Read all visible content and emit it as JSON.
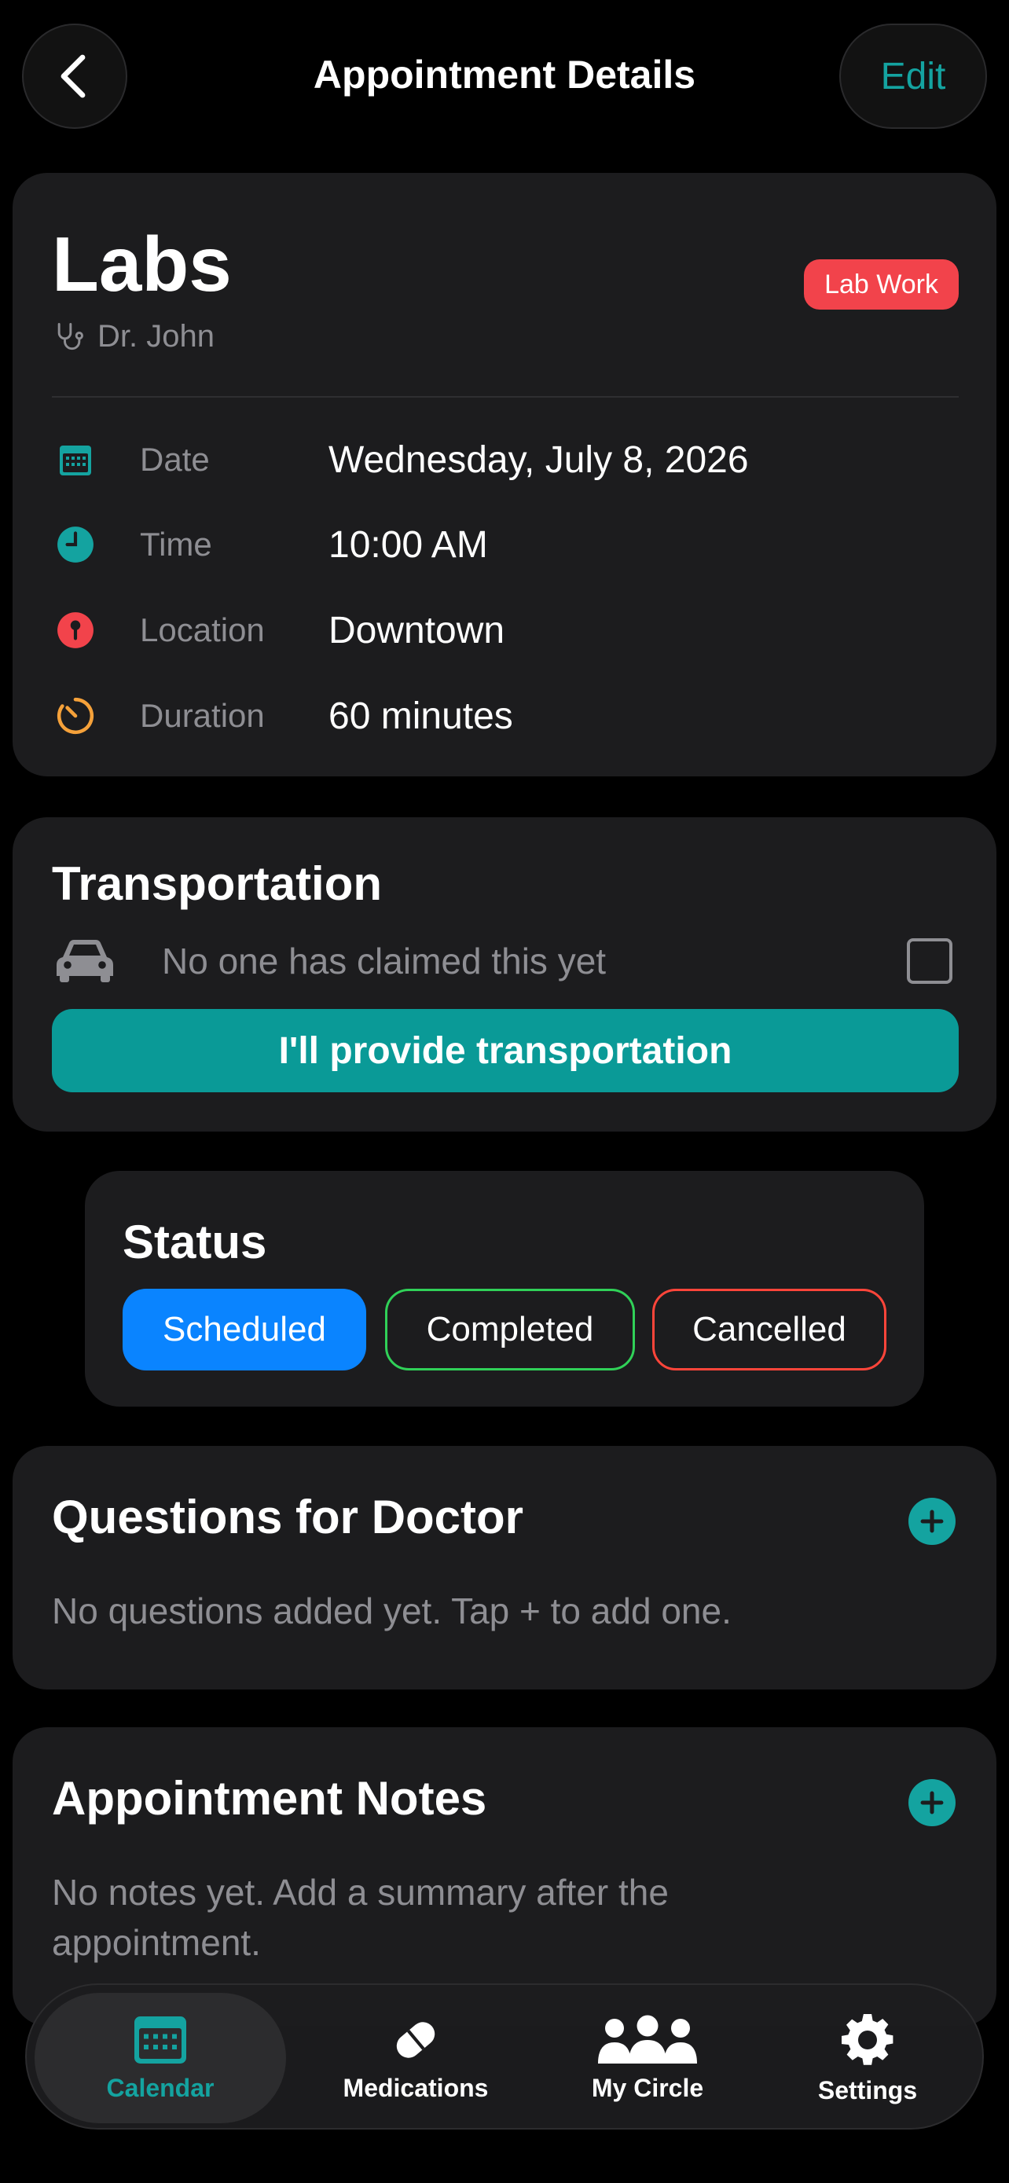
{
  "header": {
    "title": "Appointment Details",
    "edit_label": "Edit",
    "back_icon": "chevron-left-icon"
  },
  "appointment": {
    "title": "Labs",
    "doctor": "Dr. John",
    "type_badge": "Lab Work",
    "badge_color": "#f2434b",
    "details": [
      {
        "label": "Date",
        "value": "Wednesday, July 8, 2026",
        "icon": "calendar-icon",
        "color": "#14a3a0"
      },
      {
        "label": "Time",
        "value": "10:00 AM",
        "icon": "clock-icon",
        "color": "#14a3a0"
      },
      {
        "label": "Location",
        "value": "Downtown",
        "icon": "location-pin-icon",
        "color": "#f2434b"
      },
      {
        "label": "Duration",
        "value": "60 minutes",
        "icon": "timer-icon",
        "color": "#f5a13a"
      }
    ]
  },
  "transportation": {
    "title": "Transportation",
    "status": "No one has claimed this yet",
    "claimed": false,
    "button_label": "I'll provide transportation",
    "accent": "#0a9a97"
  },
  "status": {
    "title": "Status",
    "options": [
      "Scheduled",
      "Completed",
      "Cancelled"
    ],
    "selected": "Scheduled"
  },
  "questions": {
    "title": "Questions for Doctor",
    "empty_text": "No questions added yet. Tap + to add one."
  },
  "notes": {
    "title": "Appointment Notes",
    "empty_text": "No notes yet. Add a summary after the appointment."
  },
  "tabbar": {
    "active": "Calendar",
    "tabs": [
      {
        "label": "Calendar",
        "icon": "calendar-icon"
      },
      {
        "label": "Medications",
        "icon": "pill-icon"
      },
      {
        "label": "My Circle",
        "icon": "people-icon"
      },
      {
        "label": "Settings",
        "icon": "gear-icon"
      }
    ]
  }
}
